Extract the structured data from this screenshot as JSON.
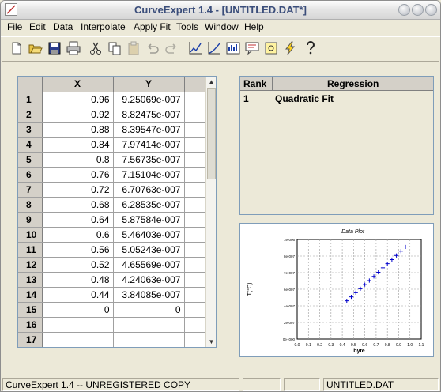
{
  "window": {
    "title": "CurveExpert 1.4 - [UNTITLED.DAT*]"
  },
  "menu": [
    "File",
    "Edit",
    "Data",
    "Interpolate",
    "Apply Fit",
    "Tools",
    "Window",
    "Help"
  ],
  "toolbar": [
    "new-icon",
    "open-icon",
    "save-icon",
    "print-icon",
    "cut-icon",
    "copy-icon",
    "paste-icon",
    "undo-icon",
    "redo-icon",
    "chart-icon",
    "curve-icon",
    "histogram-icon",
    "comment-icon",
    "image-icon",
    "lightning-icon",
    "help-icon"
  ],
  "grid": {
    "headers": [
      "X",
      "Y"
    ],
    "rows": [
      {
        "n": "1",
        "x": "0.96",
        "y": "9.25069e-007"
      },
      {
        "n": "2",
        "x": "0.92",
        "y": "8.82475e-007"
      },
      {
        "n": "3",
        "x": "0.88",
        "y": "8.39547e-007"
      },
      {
        "n": "4",
        "x": "0.84",
        "y": "7.97414e-007"
      },
      {
        "n": "5",
        "x": "0.8",
        "y": "7.56735e-007"
      },
      {
        "n": "6",
        "x": "0.76",
        "y": "7.15104e-007"
      },
      {
        "n": "7",
        "x": "0.72",
        "y": "6.70763e-007"
      },
      {
        "n": "8",
        "x": "0.68",
        "y": "6.28535e-007"
      },
      {
        "n": "9",
        "x": "0.64",
        "y": "5.87584e-007"
      },
      {
        "n": "10",
        "x": "0.6",
        "y": "5.46403e-007"
      },
      {
        "n": "11",
        "x": "0.56",
        "y": "5.05243e-007"
      },
      {
        "n": "12",
        "x": "0.52",
        "y": "4.65569e-007"
      },
      {
        "n": "13",
        "x": "0.48",
        "y": "4.24063e-007"
      },
      {
        "n": "14",
        "x": "0.44",
        "y": "3.84085e-007"
      },
      {
        "n": "15",
        "x": "0",
        "y": "0"
      },
      {
        "n": "16",
        "x": "",
        "y": ""
      },
      {
        "n": "17",
        "x": "",
        "y": ""
      }
    ]
  },
  "regression": {
    "headers": {
      "rank": "Rank",
      "regression": "Regression"
    },
    "rows": [
      {
        "rank": "1",
        "name": "Quadratic Fit"
      }
    ]
  },
  "plot": {
    "title": "Data Plot",
    "xlabel": "byte",
    "ylabel": "T(°C)",
    "xticks": [
      "0.0",
      "0.1",
      "0.2",
      "0.3",
      "0.4",
      "0.5",
      "0.6",
      "0.7",
      "0.8",
      "0.9",
      "1.0",
      "1.1"
    ],
    "yticks": [
      "0e+000",
      "2e-007",
      "4e-007",
      "6e-007",
      "7e-007",
      "8e-007",
      "1e-006"
    ]
  },
  "chart_data": {
    "type": "scatter",
    "title": "Data Plot",
    "xlabel": "byte",
    "ylabel": "T(°C)",
    "xlim": [
      0.0,
      1.1
    ],
    "ylim": [
      0,
      1e-06
    ],
    "grid": true,
    "series": [
      {
        "color": "#0000cc",
        "marker": "+",
        "x": [
          0.96,
          0.92,
          0.88,
          0.84,
          0.8,
          0.76,
          0.72,
          0.68,
          0.64,
          0.6,
          0.56,
          0.52,
          0.48,
          0.44
        ],
        "y": [
          9.25069e-07,
          8.82475e-07,
          8.39547e-07,
          7.97414e-07,
          7.56735e-07,
          7.15104e-07,
          6.70763e-07,
          6.28535e-07,
          5.87584e-07,
          5.46403e-07,
          5.05243e-07,
          4.65569e-07,
          4.24063e-07,
          3.84085e-07
        ]
      }
    ]
  },
  "status": {
    "left": "CurveExpert 1.4 -- UNREGISTERED COPY",
    "file": "UNTITLED.DAT"
  }
}
